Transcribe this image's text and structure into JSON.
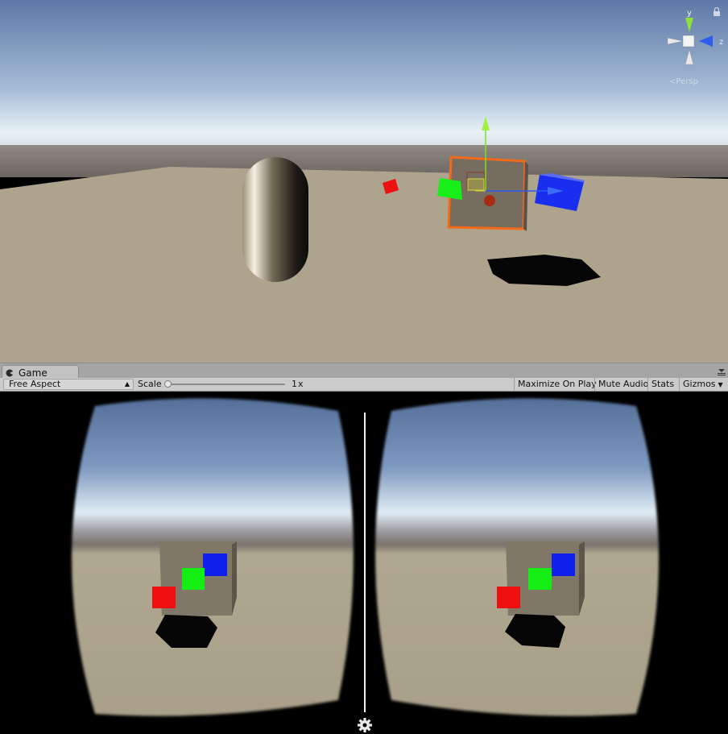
{
  "scene": {
    "gizmo_labels": {
      "y": "y",
      "z": "z",
      "projection": "Persp"
    }
  },
  "game_tab": {
    "label": "Game"
  },
  "toolbar": {
    "aspect": "Free Aspect",
    "scale_label": "Scale",
    "scale_value": "1x",
    "scale_fraction": 0.0,
    "maximize_on_play": "Maximize On Play",
    "mute_audio": "Mute Audio",
    "stats": "Stats",
    "gizmos": "Gizmos"
  },
  "colors": {
    "sky_top": "#5e79a6",
    "sky_horizon": "#e6f0f6",
    "ground": "#ada48e",
    "selection_outline": "#f26a1a",
    "cube_face": "#756b5e",
    "red_marker": "#ef0f0f",
    "green_marker": "#14f014",
    "blue_marker": "#1030ee"
  },
  "icons": [
    "scene-gizmo-icon",
    "lock-icon",
    "game-tab-icon",
    "tab-menu-icon",
    "dropdown-caret-icon",
    "cardboard-gear-icon"
  ]
}
